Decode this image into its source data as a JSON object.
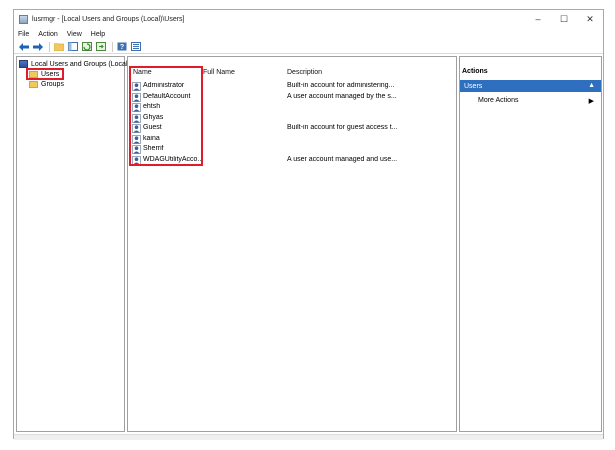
{
  "window": {
    "title": "lusrmgr - [Local Users and Groups (Local)\\Users]",
    "controls": {
      "minimize": "–",
      "maximize": "☐",
      "close": "✕"
    }
  },
  "menu": [
    "File",
    "Action",
    "View",
    "Help"
  ],
  "toolbar_icons": [
    "back-arrow-icon",
    "forward-arrow-icon",
    "up-folder-icon",
    "show-hide-tree-icon",
    "refresh-icon",
    "export-list-icon",
    "help-icon",
    "properties-icon"
  ],
  "tree": {
    "root": "Local Users and Groups (Local)",
    "children": [
      "Users",
      "Groups"
    ],
    "selected": "Users"
  },
  "list": {
    "columns": {
      "name": "Name",
      "full_name": "Full Name",
      "description": "Description"
    },
    "rows": [
      {
        "name": "Administrator",
        "full_name": "",
        "description": "Built-in account for administering..."
      },
      {
        "name": "DefaultAccount",
        "full_name": "",
        "description": "A user account managed by the s..."
      },
      {
        "name": "ehtsh",
        "full_name": "",
        "description": ""
      },
      {
        "name": "Ghyas",
        "full_name": "",
        "description": ""
      },
      {
        "name": "Guest",
        "full_name": "",
        "description": "Built-in account for guest access t..."
      },
      {
        "name": "kaina",
        "full_name": "",
        "description": ""
      },
      {
        "name": "Sherrif",
        "full_name": "",
        "description": ""
      },
      {
        "name": "WDAGUtilityAcco...",
        "full_name": "",
        "description": "A user account managed and use..."
      }
    ]
  },
  "actions": {
    "header": "Actions",
    "section": "Users",
    "items": [
      "More Actions"
    ]
  },
  "colors": {
    "highlight": "#e01b2b",
    "selection": "#2f6fc0"
  }
}
